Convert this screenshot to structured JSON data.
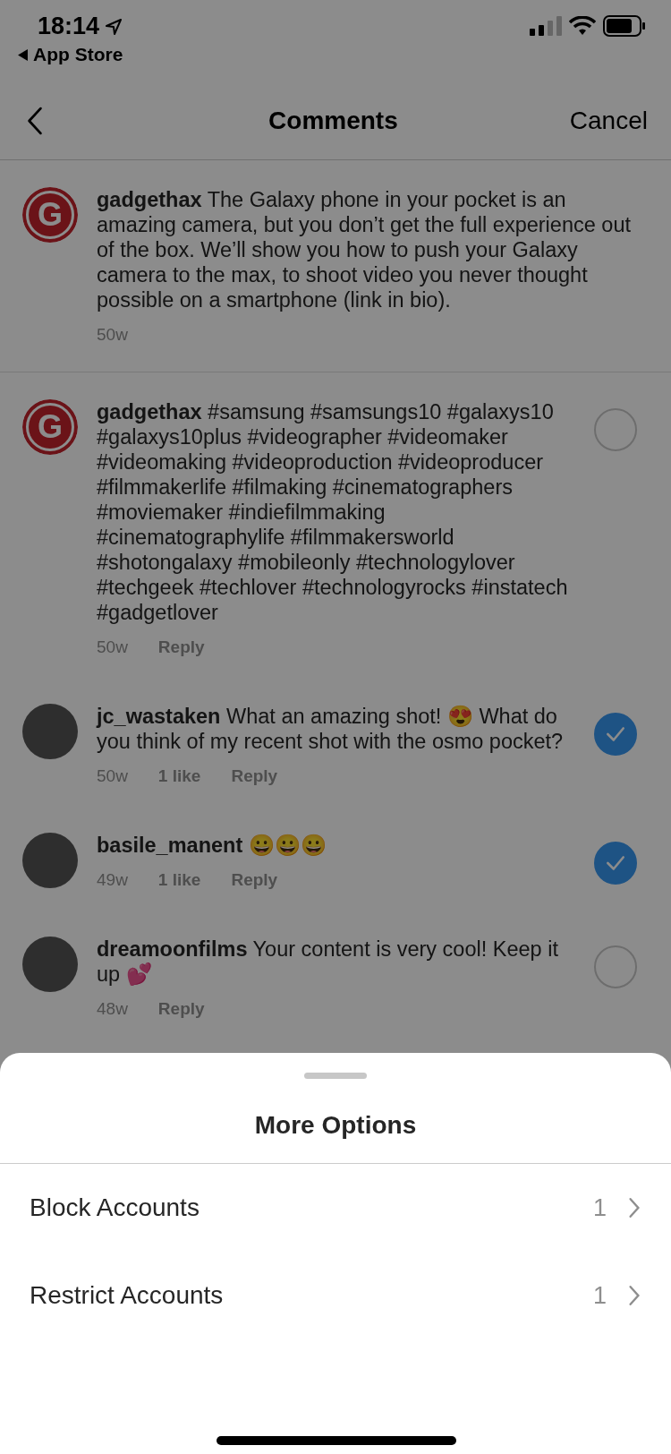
{
  "status_bar": {
    "time": "18:14",
    "back_app": "App Store"
  },
  "nav": {
    "title": "Comments",
    "action": "Cancel"
  },
  "comments": [
    {
      "kind": "logo",
      "avatar_letter": "G",
      "user": "gadgethax",
      "text": "The Galaxy phone in your pocket is an amazing camera, but you don’t get the full experience out of the box. We’ll show you how to push your Galaxy camera to the max, to shoot video you never thought possible on a smartphone (link in bio).",
      "meta": [
        "50w"
      ]
    },
    {
      "kind": "logo",
      "avatar_letter": "G",
      "user": "gadgethax",
      "text": "#samsung #samsungs10 #galaxys10 #galaxys10plus #videographer #videomaker #videomaking #videoproduction #videoproducer #filmmakerlife #filmaking #cinematographers #moviemaker #indiefilmmaking #cinematographylife #filmmakersworld #shotongalaxy #mobileonly #technologylover #techgeek #techlover #technologyrocks #instatech #gadgetlover",
      "meta": [
        "50w",
        "Reply"
      ],
      "selected": false
    },
    {
      "kind": "photo",
      "user": "jc_wastaken",
      "text": "What an amazing shot! 😍 What do you think of my recent shot with the osmo pocket?",
      "meta": [
        "50w",
        "1 like",
        "Reply"
      ],
      "selected": true
    },
    {
      "kind": "photo",
      "user": "basile_manent",
      "text": "😀😀😀",
      "meta": [
        "49w",
        "1 like",
        "Reply"
      ],
      "selected": true
    },
    {
      "kind": "photo",
      "user": "dreamoonfilms",
      "text": "Your content is very cool! Keep it up 💕",
      "meta": [
        "48w",
        "Reply"
      ],
      "selected": false
    }
  ],
  "sheet": {
    "title": "More Options",
    "rows": [
      {
        "label": "Block Accounts",
        "count": "1"
      },
      {
        "label": "Restrict Accounts",
        "count": "1"
      }
    ]
  }
}
